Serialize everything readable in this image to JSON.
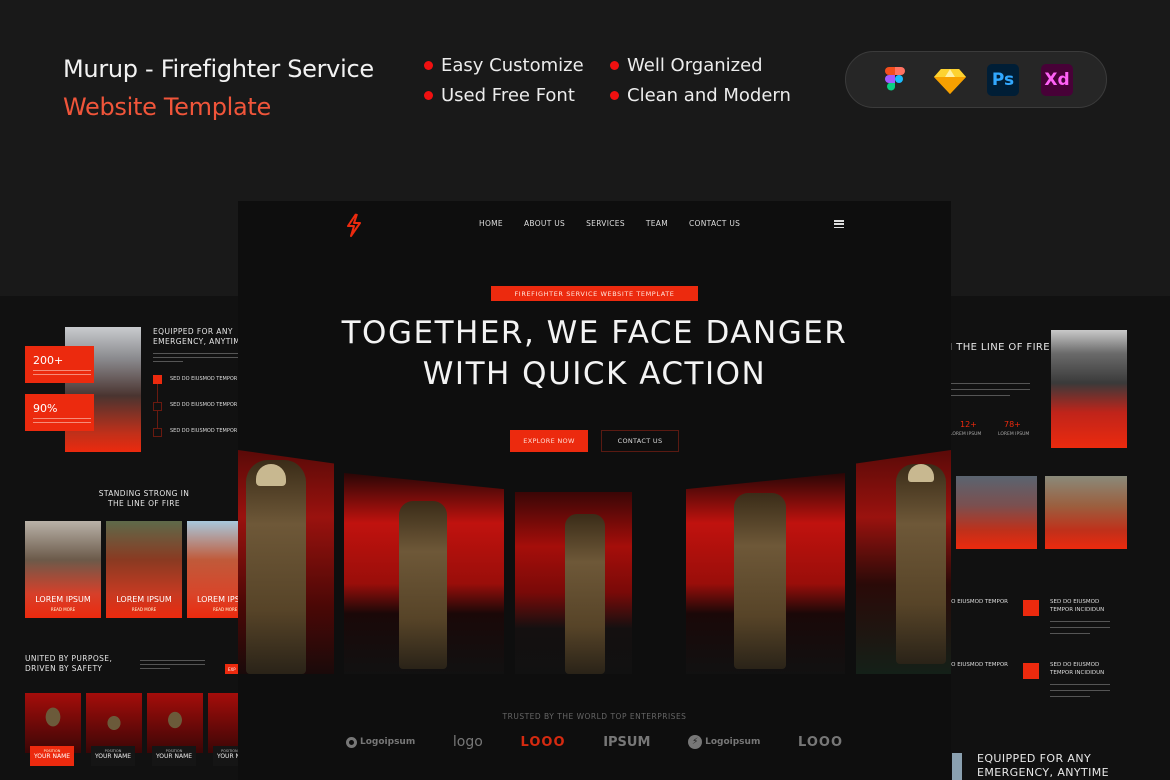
{
  "header": {
    "title_line1": "Murup - Firefighter Service",
    "title_line2": "Website Template",
    "features": [
      "Easy Customize",
      "Used Free Font",
      "Well Organized",
      "Clean and Modern"
    ],
    "tools": [
      {
        "name": "figma-icon",
        "label": ""
      },
      {
        "name": "sketch-icon",
        "label": ""
      },
      {
        "name": "photoshop-icon",
        "label": "Ps"
      },
      {
        "name": "xd-icon",
        "label": "Xd"
      }
    ]
  },
  "colors": {
    "accent": "#ec2a0e",
    "title_accent": "#f0553a",
    "bullet": "#f01010",
    "background": "#191919"
  },
  "main": {
    "nav": [
      "HOME",
      "ABOUT US",
      "SERVICES",
      "TEAM",
      "CONTACT US"
    ],
    "tag": "FIREFIGHTER SERVICE WEBSITE TEMPLATE",
    "headline_line1": "TOGETHER, WE FACE DANGER",
    "headline_line2": "WITH QUICK ACTION",
    "explore_button": "EXPLORE NOW",
    "contact_button": "CONTACT US",
    "trusted": "TRUSTED BY THE WORLD TOP ENTERPRISES",
    "logos": [
      "Logoipsum",
      "logo",
      "LOOO",
      "IPSUM",
      "Logoipsum",
      "LOOO"
    ]
  },
  "left_panel": {
    "stats": [
      {
        "value": "200+"
      },
      {
        "value": "90%"
      }
    ],
    "equipped_title": "EQUIPPED FOR ANY EMERGENCY, ANYTIME",
    "list_items": [
      "SED DO EIUSMOD TEMPOR INCIDIDUN",
      "SED DO EIUSMOD TEMPOR INCIDIDUN",
      "SED DO EIUSMOD TEMPOR INCIDIDUN"
    ],
    "standing_title": "STANDING STRONG IN THE LINE OF FIRE",
    "cards": [
      {
        "title": "LOREM IPSUM",
        "link": "READ MORE"
      },
      {
        "title": "LOREM IPSUM",
        "link": "READ MORE"
      },
      {
        "title": "LOREM IPSUM",
        "link": "READ MORE"
      }
    ],
    "united_title": "UNITED BY PURPOSE, DRIVEN BY SAFETY",
    "explore_button": "EXP",
    "team": [
      {
        "position": "POSITION",
        "name": "YOUR NAME"
      },
      {
        "position": "POSITION",
        "name": "YOUR NAME"
      },
      {
        "position": "POSITION",
        "name": "YOUR NAME"
      },
      {
        "position": "POSITION",
        "name": "YOUR NA"
      }
    ]
  },
  "right_panel": {
    "standing_title": "STANDING STRONG IN THE LINE OF FIRE",
    "stats": [
      {
        "value": "12+",
        "label": "LOREM IPSUM"
      },
      {
        "value": "78+",
        "label": "LOREM IPSUM"
      }
    ],
    "services": [
      "SED DO EIUSMOD TEMPOR INCIDIDUN",
      "SED DO EIUSMOD TEMPOR INCIDIDUN",
      "SED DO EIUSMOD TEMPOR INCIDIDUN",
      "SED DO EIUSMOD TEMPOR INCIDIDUN"
    ],
    "equipped_title": "EQUIPPED FOR ANY EMERGENCY, ANYTIME"
  }
}
